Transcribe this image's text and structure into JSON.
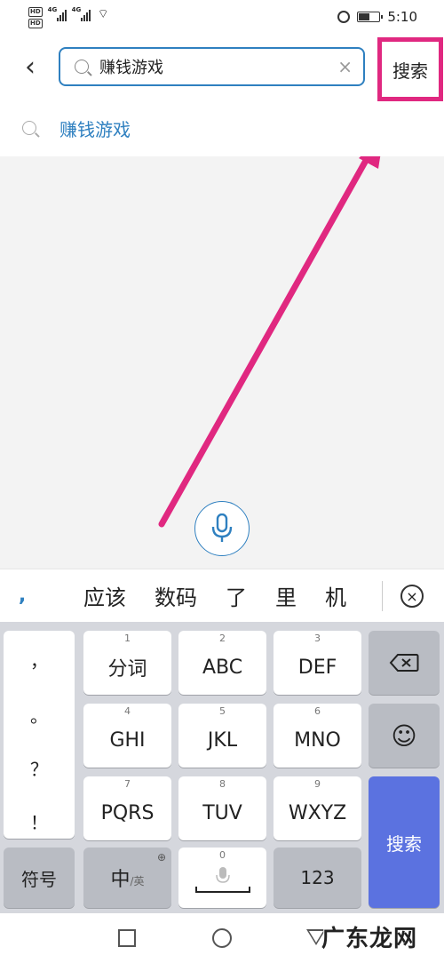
{
  "status_bar": {
    "hd_label": "HD",
    "network_label": "4G",
    "time": "5:10",
    "battery_level": 0.55
  },
  "header": {
    "back_glyph": "‹",
    "search_value": "赚钱游戏",
    "clear_glyph": "×",
    "search_button_label": "搜索"
  },
  "suggestion": {
    "text": "赚钱游戏"
  },
  "candidates": {
    "punct": ",",
    "words": [
      "应该",
      "数码",
      "了",
      "里",
      "机"
    ],
    "close_glyph": "×"
  },
  "keyboard": {
    "punct": [
      "，",
      "。",
      "？",
      "！"
    ],
    "keys": [
      {
        "num": "1",
        "label": "分词"
      },
      {
        "num": "2",
        "label": "ABC"
      },
      {
        "num": "3",
        "label": "DEF"
      },
      {
        "num": "4",
        "label": "GHI"
      },
      {
        "num": "5",
        "label": "JKL"
      },
      {
        "num": "6",
        "label": "MNO"
      },
      {
        "num": "7",
        "label": "PQRS"
      },
      {
        "num": "8",
        "label": "TUV"
      },
      {
        "num": "9",
        "label": "WXYZ"
      }
    ],
    "symbol_key": "符号",
    "lang_key_main": "中",
    "lang_key_sub": "/英",
    "space_num": "0",
    "numeric_key": "123",
    "search_key": "搜索",
    "backspace_icon": "backspace-icon",
    "emoji_glyph": "☺"
  },
  "watermark": "广东龙网",
  "colors": {
    "accent_blue": "#2f80c0",
    "highlight_pink": "#e02880",
    "search_key_blue": "#5b72e0"
  }
}
